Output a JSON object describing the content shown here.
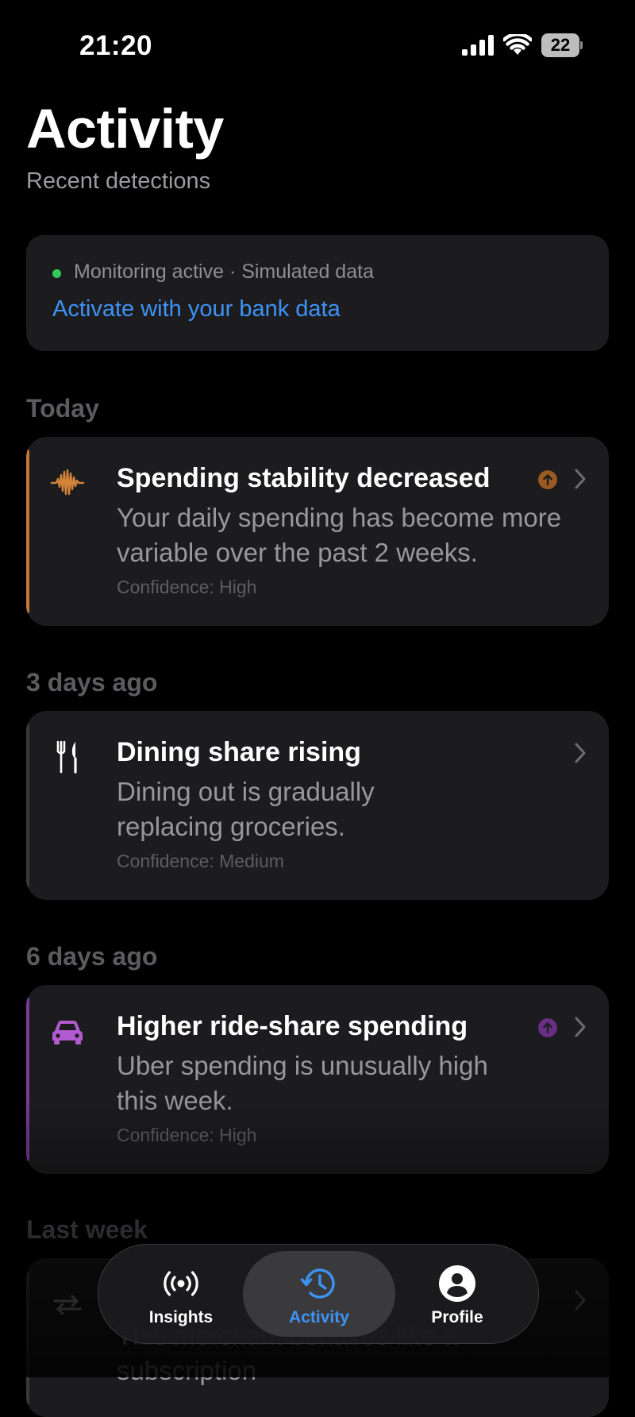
{
  "status_bar": {
    "time": "21:20",
    "battery": "22"
  },
  "header": {
    "title": "Activity",
    "subtitle": "Recent detections"
  },
  "banner": {
    "status": "Monitoring active · Simulated data",
    "link": "Activate with your bank data",
    "dot_color": "#34c759",
    "link_color": "#3d93f5"
  },
  "sections": [
    {
      "label": "Today",
      "card": {
        "icon": "waveform-icon",
        "accent_color": "#c07a32",
        "title": "Spending stability decreased",
        "description": "Your daily spending has become more variable over the past 2 weeks.",
        "confidence": "Confidence: High",
        "trend_icon": "arrow-up-circle-icon"
      }
    },
    {
      "label": "3 days ago",
      "card": {
        "icon": "fork-knife-icon",
        "accent_color": "#3a3a3c",
        "title": "Dining share rising",
        "description": "Dining out is gradually replacing groceries.",
        "confidence": "Confidence: Medium"
      }
    },
    {
      "label": "6 days ago",
      "card": {
        "icon": "car-icon",
        "accent_color": "#7a3a9a",
        "title": "Higher ride-share spending",
        "description": "Uber spending is unusually high this week.",
        "confidence": "Confidence: High",
        "trend_icon": "arrow-up-circle-icon"
      }
    },
    {
      "label": "Last week",
      "card": {
        "icon": "repeat-icon",
        "description": "This merchant behaves like a subscription"
      }
    }
  ],
  "tabbar": {
    "tabs": [
      {
        "label": "Insights",
        "icon": "broadcast-icon"
      },
      {
        "label": "Activity",
        "icon": "history-icon"
      },
      {
        "label": "Profile",
        "icon": "person-circle-icon"
      }
    ],
    "active": "Activity",
    "active_color": "#3d93f5"
  }
}
